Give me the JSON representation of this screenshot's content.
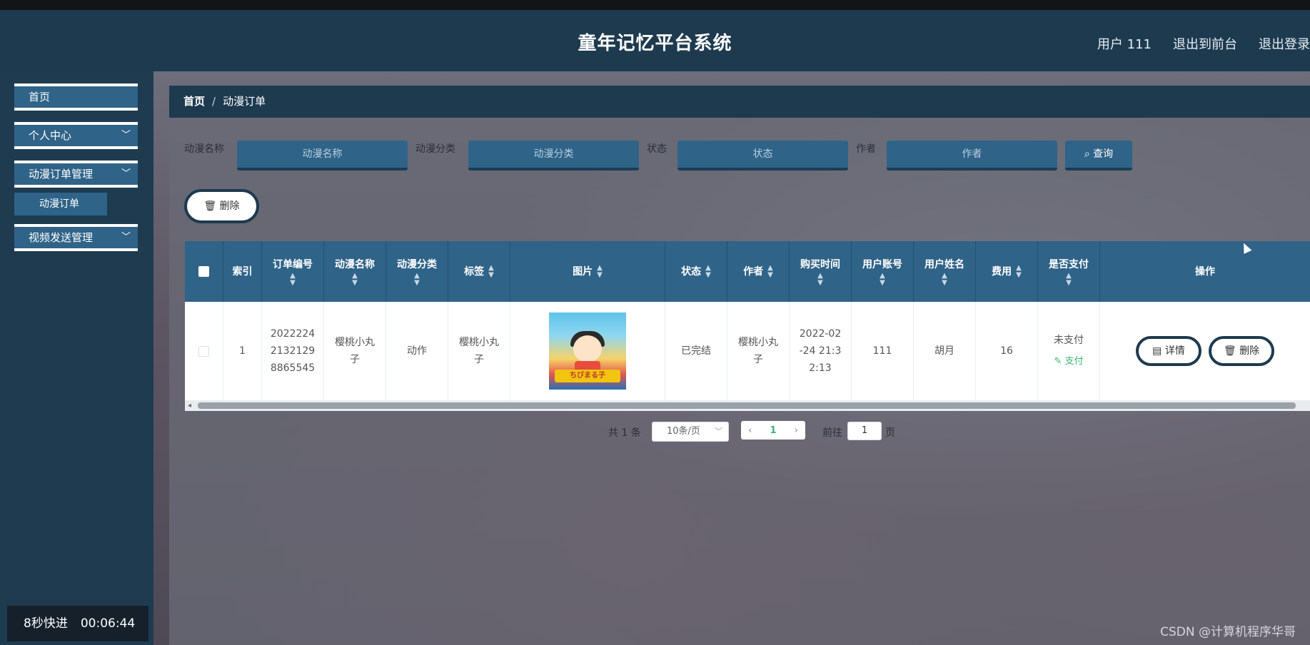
{
  "header": {
    "title": "童年记忆平台系统",
    "user": "用户 111",
    "to_front": "退出到前台",
    "logout": "退出登录"
  },
  "sidebar": {
    "items": [
      {
        "label": "首页"
      },
      {
        "label": "个人中心"
      },
      {
        "label": "动漫订单管理"
      },
      {
        "label": "动漫订单"
      },
      {
        "label": "视频发送管理"
      }
    ]
  },
  "overlay": {
    "speed": "8秒快进",
    "time": "00:06:44"
  },
  "breadcrumb": {
    "home": "首页",
    "sep": "/",
    "current": "动漫订单"
  },
  "search": {
    "name_label": "动漫名称",
    "name_placeholder": "动漫名称",
    "category_label": "动漫分类",
    "category_placeholder": "动漫分类",
    "status_label": "状态",
    "status_placeholder": "状态",
    "author_label": "作者",
    "author_placeholder": "作者",
    "query": "查询"
  },
  "toolbar": {
    "delete": "删除"
  },
  "table": {
    "columns": [
      "索引",
      "订单编号",
      "动漫名称",
      "动漫分类",
      "标签",
      "图片",
      "状态",
      "作者",
      "购买时间",
      "用户账号",
      "用户姓名",
      "费用",
      "是否支付",
      "操作"
    ],
    "rows": [
      {
        "index": "1",
        "order_no": "20222242132129 8865545",
        "order_no_lines": [
          "2022224",
          "2132129",
          "8865545"
        ],
        "name_lines": [
          "樱桃小丸",
          "子"
        ],
        "category": "动作",
        "tag_lines": [
          "樱桃小丸",
          "子"
        ],
        "status": "已完结",
        "author_lines": [
          "樱桃小丸",
          "子"
        ],
        "time_lines": [
          "2022-02",
          "-24 21:3",
          "2:13"
        ],
        "account": "111",
        "user_name": "胡月",
        "fee": "16",
        "paid": "未支付",
        "pay": "支付",
        "detail": "详情",
        "delete": "删除"
      }
    ]
  },
  "pagination": {
    "total": "共 1 条",
    "page_size": "10条/页",
    "current": "1",
    "goto": "前往",
    "goto_value": "1",
    "unit": "页"
  },
  "watermark": "CSDN @计算机程序华哥"
}
